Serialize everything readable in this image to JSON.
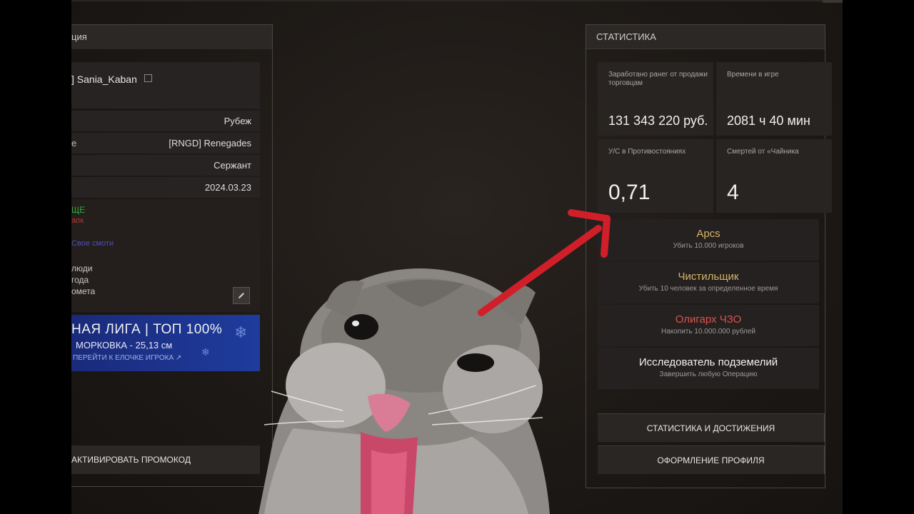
{
  "left_panel": {
    "header_title": "ция",
    "nickname": "] Sania_Kaban",
    "rows": [
      {
        "key": "",
        "value": "Рубеж"
      },
      {
        "key": "e",
        "value": "[RNGD] Renegades"
      },
      {
        "key": "",
        "value": "Сержант"
      },
      {
        "key": "",
        "value": "2024.03.23"
      }
    ],
    "quests": {
      "q1": "ЩЕ",
      "q2": "аок",
      "q3": "Свое смоти",
      "q4": "люди",
      "q5": "года",
      "q6": "омета"
    },
    "banner": {
      "title": "НАЯ ЛИГА  |  ТОП 100%",
      "subtitle": "МОРКОВКА - 25,13 см",
      "link": "ПЕРЕЙТИ К ЕЛОЧКЕ ИГРОКА"
    },
    "promo_button": "АКТИВИРОВАТЬ ПРОМОКОД"
  },
  "stats_panel": {
    "header_title": "СТАТИСТИКА",
    "cards": [
      {
        "label": "Заработано ранег от продажи торговцам",
        "value": "131 343 220 руб."
      },
      {
        "label": "Времени в игре",
        "value": "2081 ч 40 мин"
      },
      {
        "label": "У/С в Противостояниях",
        "value": "0,71"
      },
      {
        "label": "Смертей от «Чайника",
        "value": "4"
      }
    ],
    "achievements": [
      {
        "name": "Apcs",
        "desc": "Убить 10.000 игроков",
        "color": "#d6b46a"
      },
      {
        "name": "Чистильщик",
        "desc": "Убить 10 человек за определенное время",
        "color": "#d6b46a"
      },
      {
        "name": "Олигарх ЧЗО",
        "desc": "Накопить 10.000.000 рублей",
        "color": "#d9534f"
      },
      {
        "name": "Исследователь подземелий",
        "desc": "Завершить любую Операцию",
        "color": "#f2f2f2"
      }
    ],
    "buttons": {
      "stats": "СТАТИСТИКА И ДОСТИЖЕНИЯ",
      "profile": "ОФОРМЛЕНИЕ ПРОФИЛЯ"
    }
  },
  "overlay": {
    "arrow_color": "#d11f2a"
  }
}
